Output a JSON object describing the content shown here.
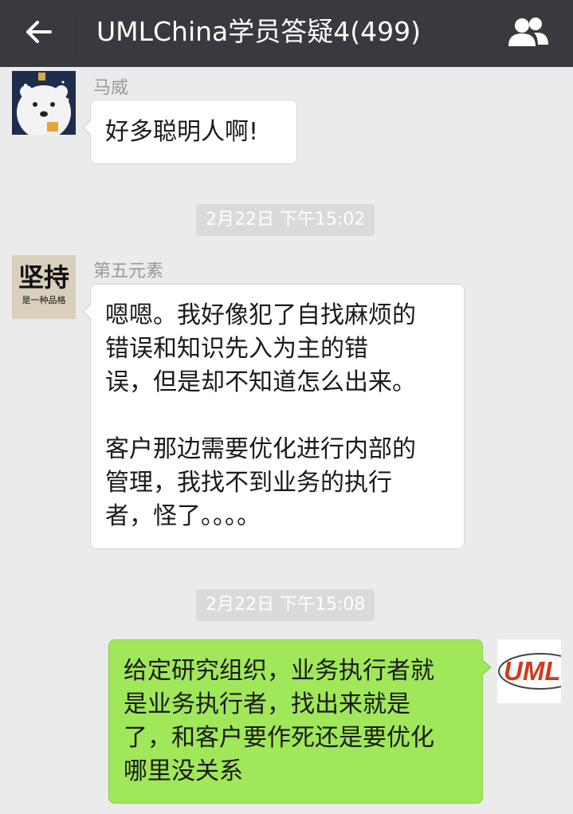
{
  "header": {
    "title": "UMLChina学员答疑4(499)",
    "back_icon": "back-arrow-icon",
    "group_icon": "group-members-icon",
    "background": "#393a3f"
  },
  "messages": [
    {
      "sender": "马威",
      "text": "好多聪明人啊!",
      "direction": "incoming",
      "avatar": "polar-bear-avatar"
    },
    {
      "sender": "第五元素",
      "text": "嗯嗯。我好像犯了自找麻烦的\n错误和知识先入为主的错\n误，但是却不知道怎么出来。\n\n客户那边需要优化进行内部的\n管理，我找不到业务的执行\n者，怪了。。。。",
      "direction": "incoming",
      "avatar": {
        "name": "jianchi-avatar",
        "line1": "坚持",
        "line2": "是一种品格"
      }
    },
    {
      "text": "给定研究组织，业务执行者就\n是业务执行者，找出来就是\n了，和客户要作死还是要优化\n哪里没关系",
      "direction": "outgoing",
      "avatar": {
        "name": "umlchina-logo-avatar",
        "logo_text": "UMLC"
      }
    }
  ],
  "timestamps": [
    "2月22日 下午15:02",
    "2月22日 下午15:08"
  ],
  "colors": {
    "chat_background": "#ebebeb",
    "incoming_bubble": "#ffffff",
    "outgoing_bubble": "#a0e75a",
    "timestamp_bg": "#dadada",
    "logo_red": "#d23a1a"
  }
}
